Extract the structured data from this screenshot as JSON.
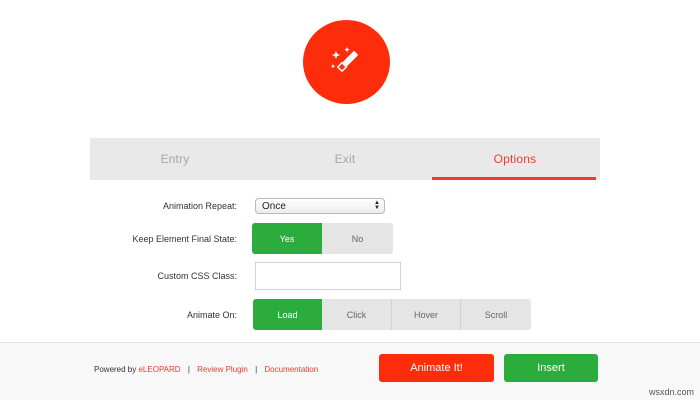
{
  "hero": {
    "icon": "magic-wand-icon",
    "color": "#fd2d0c"
  },
  "tabs": [
    {
      "label": "Entry",
      "active": false
    },
    {
      "label": "Exit",
      "active": false
    },
    {
      "label": "Options",
      "active": true
    }
  ],
  "form": {
    "repeat": {
      "label": "Animation Repeat:",
      "value": "Once"
    },
    "final_state": {
      "label": "Keep Element Final State:",
      "options": [
        "Yes",
        "No"
      ],
      "selected": "Yes"
    },
    "css_class": {
      "label": "Custom CSS Class:",
      "value": ""
    },
    "animate_on": {
      "label": "Animate On:",
      "options": [
        "Load",
        "Click",
        "Hover",
        "Scroll"
      ],
      "selected": "Load"
    }
  },
  "footer": {
    "powered_by": "Powered by",
    "brand_link": "eLEOPARD",
    "separator": "|",
    "review_link": "Review Plugin",
    "docs_link": "Documentation",
    "animate_button": "Animate It!",
    "insert_button": "Insert"
  },
  "colors": {
    "accent_red": "#fd2d0c",
    "accent_green": "#2cac3c",
    "tab_bar": "#e9e9e9"
  },
  "watermark": "wsxdn.com"
}
